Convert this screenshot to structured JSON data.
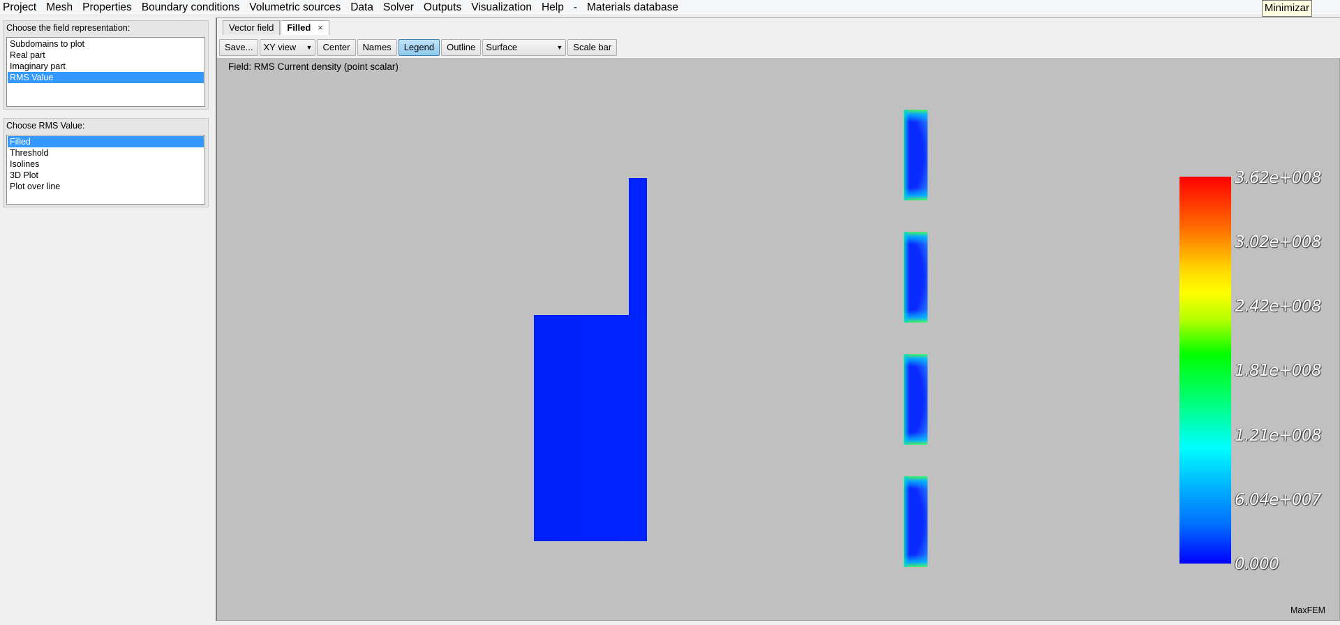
{
  "menubar": {
    "items": [
      "Project",
      "Mesh",
      "Properties",
      "Boundary conditions",
      "Volumetric sources",
      "Data",
      "Solver",
      "Outputs",
      "Visualization",
      "Help",
      "-",
      "Materials database"
    ],
    "tooltip": "Minimizar"
  },
  "representation": {
    "title": "Choose the field representation:",
    "items": [
      "Subdomains to plot",
      "Real part",
      "Imaginary part",
      "RMS Value"
    ],
    "selected": "RMS Value"
  },
  "rms": {
    "title": "Choose RMS Value:",
    "items": [
      "Filled",
      "Threshold",
      "Isolines",
      "3D Plot",
      "Plot over line"
    ],
    "selected": "Filled"
  },
  "tabs": [
    {
      "label": "Vector field",
      "active": false
    },
    {
      "label": "Filled",
      "active": true,
      "close": "×"
    }
  ],
  "toolbar": {
    "save": "Save...",
    "view": "XY view",
    "center": "Center",
    "names": "Names",
    "legend": "Legend",
    "outline": "Outline",
    "surface": "Surface",
    "scale_bar": "Scale bar"
  },
  "viewport": {
    "field_label": "Field: RMS Current density (point scalar)",
    "brand": "MaxFEM",
    "background": "#c0c0c0",
    "fill_color": "#0022ff"
  },
  "legend": {
    "labels": [
      "3.62e+008",
      "3.02e+008",
      "2.42e+008",
      "1.81e+008",
      "1.21e+008",
      "6.04e+007",
      "0.000"
    ],
    "colors": [
      "#ff0000",
      "#ffff00",
      "#00ff00",
      "#00ffff",
      "#0000ff"
    ]
  }
}
